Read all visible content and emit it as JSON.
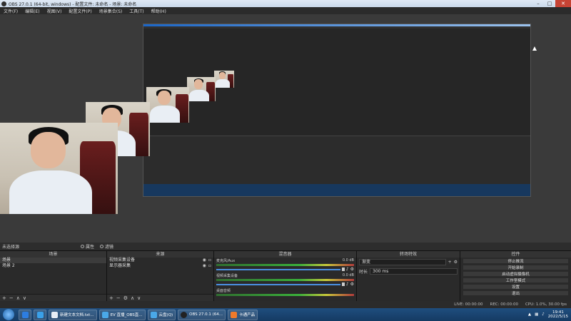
{
  "window": {
    "title": "OBS 27.0.1 (64-bit, windows) - 配置文件: 未命名 - 场景: 未命名"
  },
  "menu": [
    "文件(F)",
    "编辑(E)",
    "视图(V)",
    "配置文件(P)",
    "场景集合(S)",
    "工具(T)",
    "帮助(H)"
  ],
  "scene_bar": {
    "label": "未选择源",
    "properties": "属性",
    "filters": "滤镜"
  },
  "docks": {
    "scenes": {
      "title": "场景",
      "items": [
        "场景",
        "场景 2"
      ],
      "selected": 0
    },
    "sources": {
      "title": "来源",
      "items": [
        "视频采集设备",
        "显示器采集"
      ]
    },
    "mixer": {
      "title": "混音器",
      "tracks": [
        {
          "name": "麦克风/Aux",
          "db": "0.0 dB"
        },
        {
          "name": "视频采集设备",
          "db": "0.0 dB"
        },
        {
          "name": "桌面音频",
          "db": ""
        }
      ]
    },
    "transitions": {
      "title": "转场特效",
      "type": "渐变",
      "duration_label": "时长",
      "duration": "300 ms"
    },
    "controls": {
      "title": "控件",
      "buttons": [
        "停止推流",
        "开始录制",
        "启动虚拟摄像机",
        "工作室模式",
        "设置",
        "退出"
      ]
    }
  },
  "status": {
    "live": "LIVE: 00:00:00",
    "rec": "REC: 00:00:00",
    "cpu": "CPU: 1.0%, 30.00 fps"
  },
  "taskbar": {
    "items": [
      "新建文本文档.txt...",
      "EV 直播_OBS直...",
      "云盘(Q)",
      "OBS 27.0.1 (64...",
      "卡通产品"
    ],
    "time": "19:41",
    "date": "2022/5/15"
  }
}
